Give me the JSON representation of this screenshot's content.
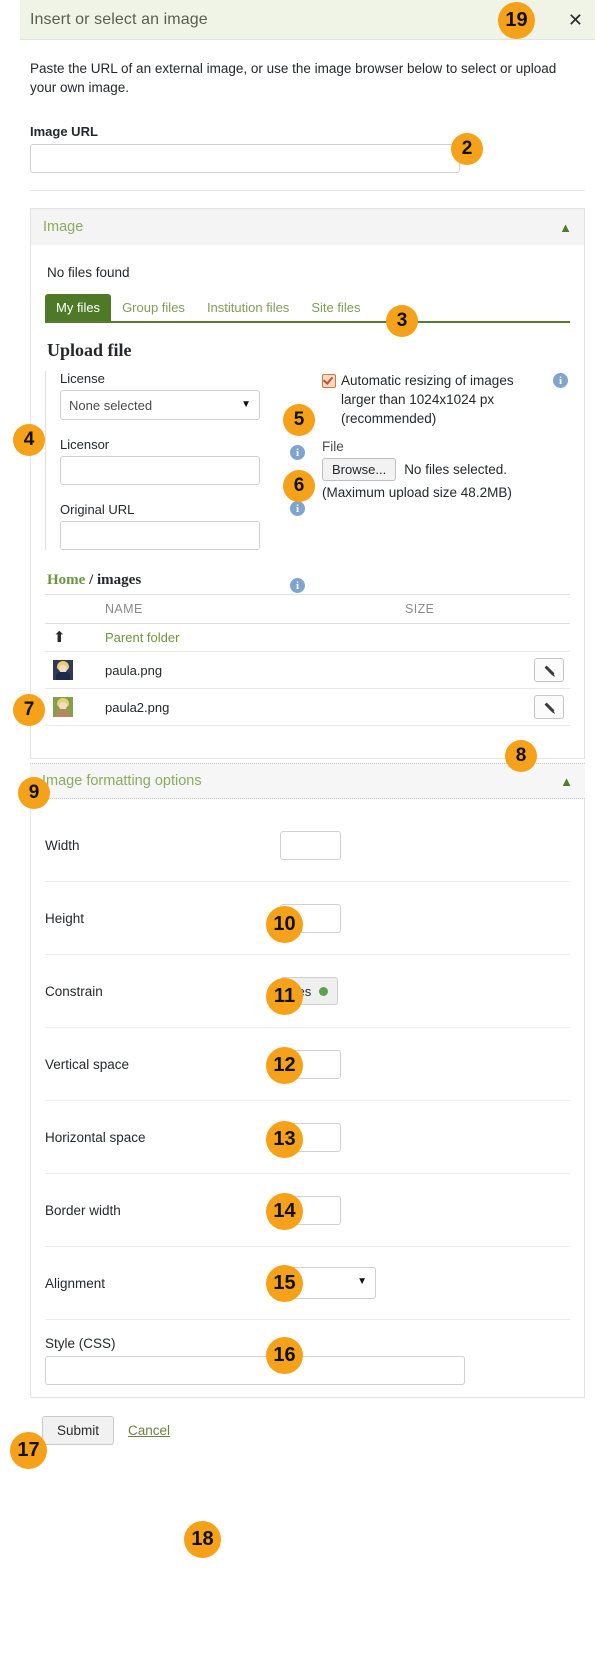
{
  "dialog": {
    "title": "Insert or select an image",
    "close_icon": "close-icon",
    "intro": "Paste the URL of an external image, or use the image browser below to select or upload your own image."
  },
  "image_url": {
    "label": "Image URL",
    "value": "",
    "placeholder": ""
  },
  "image_panel": {
    "title": "Image",
    "collapse_icon": "chevron-up-icon",
    "no_files_text": "No files found",
    "tabs": [
      {
        "label": "My files",
        "active": true
      },
      {
        "label": "Group files",
        "active": false
      },
      {
        "label": "Institution files",
        "active": false
      },
      {
        "label": "Site files",
        "active": false
      }
    ]
  },
  "upload": {
    "heading": "Upload file",
    "license": {
      "label": "License",
      "selected": "None selected",
      "options": [
        "None selected"
      ]
    },
    "licensor": {
      "label": "Licensor",
      "value": ""
    },
    "original_url": {
      "label": "Original URL",
      "value": ""
    },
    "resize": {
      "checked": true,
      "text": "Automatic resizing of images larger than 1024x1024 px (recommended)"
    },
    "file": {
      "label": "File",
      "browse_label": "Browse...",
      "no_file_text": "No files selected.",
      "max_size_text": "(Maximum upload size 48.2MB)"
    },
    "info_icon": "info-icon"
  },
  "browser": {
    "breadcrumb": {
      "home": "Home",
      "separator": "/",
      "current": "images"
    },
    "columns": [
      "",
      "NAME",
      "SIZE",
      ""
    ],
    "parent_row": {
      "icon": "arrow-up-icon",
      "label": "Parent folder"
    },
    "rows": [
      {
        "thumb": "avatar-thumbnail",
        "name": "paula.png",
        "size": "",
        "edit_icon": "pencil-icon"
      },
      {
        "thumb": "avatar-thumbnail",
        "name": "paula2.png",
        "size": "",
        "edit_icon": "pencil-icon"
      }
    ]
  },
  "formatting": {
    "title": "Image formatting options",
    "collapse_icon": "chevron-up-icon",
    "rows": [
      {
        "label": "Width",
        "value": "",
        "type": "text"
      },
      {
        "label": "Height",
        "value": "",
        "type": "text"
      },
      {
        "label": "Constrain",
        "value": "Yes",
        "type": "toggle"
      },
      {
        "label": "Vertical space",
        "value": "",
        "type": "text"
      },
      {
        "label": "Horizontal space",
        "value": "",
        "type": "text"
      },
      {
        "label": "Border width",
        "value": "",
        "type": "text"
      },
      {
        "label": "Alignment",
        "value": "--",
        "type": "select",
        "options": [
          "--"
        ]
      }
    ],
    "style": {
      "label": "Style (CSS)",
      "value": ""
    }
  },
  "footer": {
    "submit_label": "Submit",
    "cancel_label": "Cancel"
  },
  "badges": {
    "b2": "2",
    "b3": "3",
    "b4": "4",
    "b5": "5",
    "b6": "6",
    "b7": "7",
    "b8": "8",
    "b9": "9",
    "b10": "10",
    "b11": "11",
    "b12": "12",
    "b13": "13",
    "b14": "14",
    "b15": "15",
    "b16": "16",
    "b17": "17",
    "b18": "18",
    "b19": "19"
  },
  "colors": {
    "header_bg": "#eff4e7",
    "accent_green": "#4e7a28",
    "badge_orange": "#f5a11a",
    "link_green": "#6f943f",
    "info_blue": "#7fa5cf"
  }
}
